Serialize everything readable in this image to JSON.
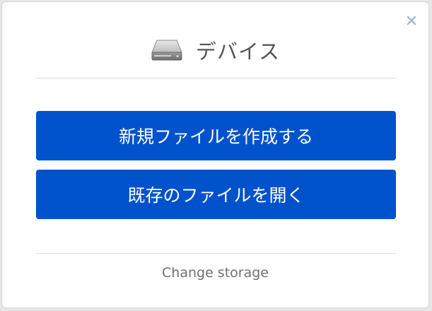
{
  "dialog": {
    "title": "デバイス",
    "icon": "hard-drive-icon",
    "close_icon": "close-icon",
    "buttons": {
      "new_file": "新規ファイルを作成する",
      "open_file": "既存のファイルを開く"
    },
    "change_storage": "Change storage"
  },
  "colors": {
    "primary_button": "#0052cc",
    "button_text": "#ffffff",
    "title_text": "#555555",
    "link_text": "#707070",
    "close_icon": "#a9b6c6"
  }
}
